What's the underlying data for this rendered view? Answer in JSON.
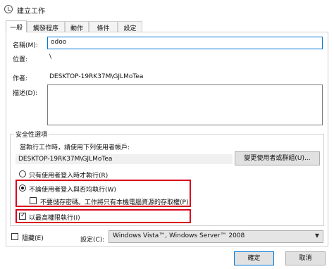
{
  "window": {
    "title": "建立工作"
  },
  "tabs": [
    {
      "label": "一般"
    },
    {
      "label": "觸發程序"
    },
    {
      "label": "動作"
    },
    {
      "label": "條件"
    },
    {
      "label": "設定"
    }
  ],
  "general": {
    "name_label": "名稱(M):",
    "name_value": "odoo",
    "location_label": "位置:",
    "location_value": "\\",
    "author_label": "作者:",
    "author_value": "DESKTOP-19RK37M\\GJLMoTea",
    "description_label": "描述(D):",
    "description_value": ""
  },
  "security": {
    "group_title": "安全性選項",
    "run_as_prompt": "當執行工作時，請使用下列使用者帳戶:",
    "run_as_user": "DESKTOP-19RK37M\\GJLMoTea",
    "change_user_button": "變更使用者或群組(U)...",
    "option_logged_on": "只有使用者登入時才執行(R)",
    "option_whether_logged": "不論使用者登入與否均執行(W)",
    "option_no_store_password": "不要儲存密碼。工作將只有本機電腦資源的存取權(P)",
    "option_highest_privileges": "以最高權限執行(I)"
  },
  "bottom": {
    "hidden_label": "隱藏(E)",
    "configure_label": "設定(C):",
    "configure_value": "Windows Vista™, Windows Server™ 2008"
  },
  "footer": {
    "ok_label": "確定",
    "cancel_label": "取消"
  },
  "state": {
    "selected_tab": "一般",
    "run_option": "不論使用者登入與否均執行(W)",
    "no_store_password": false,
    "highest_privileges": true,
    "hidden": false
  },
  "colors": {
    "highlight": "#d9001b",
    "focus_border": "#0078d7",
    "readonly_bg": "#f0f0f0"
  },
  "icons": {
    "title": "clock-icon",
    "dropdown": "chevron-down-icon",
    "check": "checkmark-icon"
  }
}
